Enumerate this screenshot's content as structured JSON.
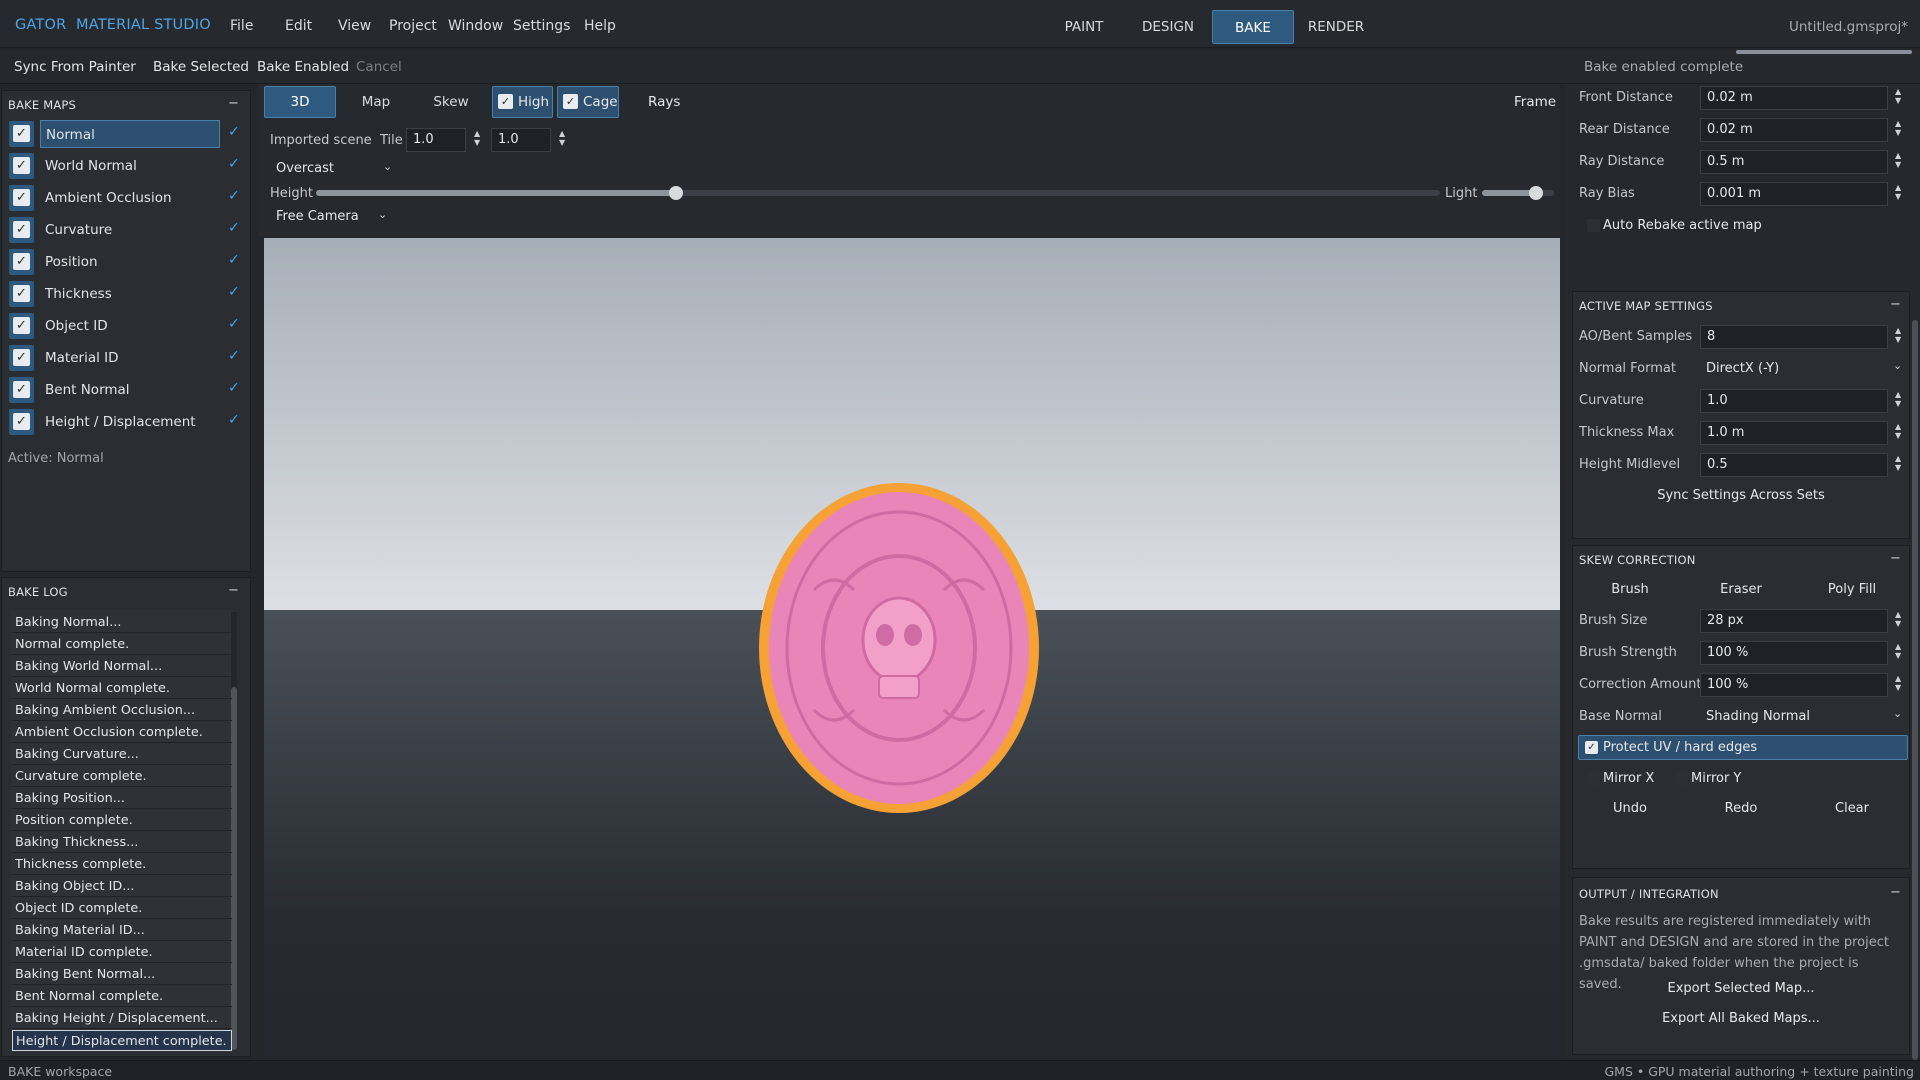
{
  "app": {
    "logo_part1": "GATOR",
    "logo_part2": "MATERIAL STUDIO",
    "title": "Untitled.gmsproj*"
  },
  "menu": [
    "File",
    "Edit",
    "View",
    "Project",
    "Window",
    "Settings",
    "Help"
  ],
  "modes": [
    "PAINT",
    "DESIGN",
    "BAKE",
    "RENDER"
  ],
  "active_mode": "BAKE",
  "toolbar": {
    "sync": "Sync From Painter",
    "bake_selected": "Bake Selected",
    "bake_enabled": "Bake Enabled",
    "cancel": "Cancel",
    "status": "Bake enabled complete",
    "progress": 1.0
  },
  "bake_maps": {
    "header": "BAKE MAPS",
    "items": [
      "Normal",
      "World Normal",
      "Ambient Occlusion",
      "Curvature",
      "Position",
      "Thickness",
      "Object ID",
      "Material ID",
      "Bent Normal",
      "Height / Displacement"
    ],
    "active_label": "Active: Normal"
  },
  "bake_log": {
    "header": "BAKE LOG",
    "lines": [
      "Baking Normal...",
      "Normal complete.",
      "Baking World Normal...",
      "World Normal complete.",
      "Baking Ambient Occlusion...",
      "Ambient Occlusion complete.",
      "Baking Curvature...",
      "Curvature complete.",
      "Baking Position...",
      "Position complete.",
      "Baking Thickness...",
      "Thickness complete.",
      "Baking Object ID...",
      "Object ID complete.",
      "Baking Material ID...",
      "Material ID complete.",
      "Baking Bent Normal...",
      "Bent Normal complete.",
      "Baking Height / Displacement...",
      "Height / Displacement complete."
    ]
  },
  "viewport": {
    "tabs": [
      "3D",
      "Map",
      "Skew"
    ],
    "high": "High",
    "cage": "Cage",
    "rays": "Rays",
    "frame": "Frame",
    "scene": "Imported scene",
    "tile": "Tile",
    "tile_u": "1.0",
    "tile_v": "1.0",
    "environment": "Overcast",
    "height": "Height",
    "light": "Light",
    "camera": "Free Camera",
    "height_slider": 0.32,
    "light_slider": 0.75
  },
  "cage": {
    "front_distance": {
      "label": "Front Distance",
      "value": "0.02  m"
    },
    "rear_distance": {
      "label": "Rear Distance",
      "value": "0.02  m"
    },
    "ray_distance": {
      "label": "Ray Distance",
      "value": "0.5  m"
    },
    "ray_bias": {
      "label": "Ray Bias",
      "value": "0.001  m"
    },
    "auto_rebake": "Auto Rebake active map"
  },
  "active_map": {
    "header": "ACTIVE MAP SETTINGS",
    "ao_samples": {
      "label": "AO/Bent Samples",
      "value": "8"
    },
    "normal_format": {
      "label": "Normal Format",
      "value": "DirectX (-Y)"
    },
    "curvature": {
      "label": "Curvature",
      "value": "1.0"
    },
    "thickness_max": {
      "label": "Thickness Max",
      "value": "1.0  m"
    },
    "height_midlevel": {
      "label": "Height Midlevel",
      "value": "0.5"
    },
    "sync_button": "Sync Settings Across Sets"
  },
  "skew": {
    "header": "SKEW CORRECTION",
    "tools": [
      "Brush",
      "Eraser",
      "Poly Fill"
    ],
    "brush_size": {
      "label": "Brush Size",
      "value": "28  px"
    },
    "brush_strength": {
      "label": "Brush Strength",
      "value": "100  %"
    },
    "correction_amount": {
      "label": "Correction Amount",
      "value": "100  %"
    },
    "base_normal": {
      "label": "Base Normal",
      "value": "Shading Normal"
    },
    "protect_uv": "Protect UV / hard edges",
    "mirror_x": "Mirror X",
    "mirror_y": "Mirror Y",
    "undo": "Undo",
    "redo": "Redo",
    "clear": "Clear"
  },
  "output": {
    "header": "OUTPUT / INTEGRATION",
    "description": "Bake results are registered immediately with PAINT and DESIGN and are stored in the project .gmsdata/ baked folder when the project is saved.",
    "export_selected": "Export Selected Map...",
    "export_all": "Export All Baked Maps..."
  },
  "statusbar": {
    "left": "BAKE workspace",
    "right": "GMS  •  GPU material authoring + texture painting"
  },
  "colors": {
    "accent": "#4ea6e6",
    "active_bg": "#2f5a80",
    "coin_fill": "#e985b8",
    "coin_rim": "#f5a136"
  }
}
